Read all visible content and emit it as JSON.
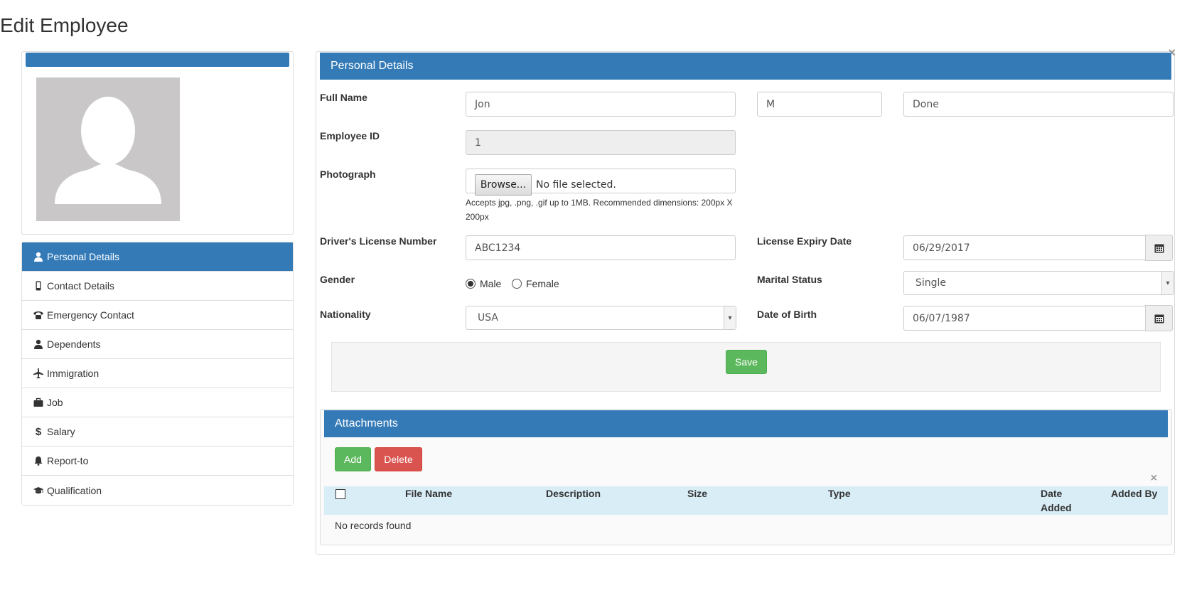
{
  "page": {
    "title": "Edit Employee"
  },
  "sidebar": {
    "items": [
      {
        "label": "Personal Details",
        "icon": "user-icon",
        "active": true
      },
      {
        "label": "Contact Details",
        "icon": "mobile-phone-icon"
      },
      {
        "label": "Emergency Contact",
        "icon": "phone-icon"
      },
      {
        "label": "Dependents",
        "icon": "user-icon"
      },
      {
        "label": "Immigration",
        "icon": "plane-icon"
      },
      {
        "label": "Job",
        "icon": "briefcase-icon"
      },
      {
        "label": "Salary",
        "icon": "dollar-icon"
      },
      {
        "label": "Report-to",
        "icon": "bell-icon"
      },
      {
        "label": "Qualification",
        "icon": "graduation-cap-icon"
      }
    ]
  },
  "personal": {
    "heading": "Personal Details",
    "full_name_label": "Full Name",
    "first_name": "Jon",
    "middle_name": "M",
    "last_name": "Done",
    "employee_id_label": "Employee ID",
    "employee_id": "1",
    "photograph_label": "Photograph",
    "browse_label": "Browse...",
    "file_status": "No file selected.",
    "photo_help_line1": "Accepts jpg, .png, .gif up to 1MB. Recommended dimensions: 200px X",
    "photo_help_line2": "200px",
    "license_label": "Driver's License Number",
    "license_number": "ABC1234",
    "license_expiry_label": "License Expiry Date",
    "license_expiry": "06/29/2017",
    "gender_label": "Gender",
    "gender_male": "Male",
    "gender_female": "Female",
    "gender_selected": "Male",
    "marital_label": "Marital Status",
    "marital_status": "Single",
    "nationality_label": "Nationality",
    "nationality": "USA",
    "dob_label": "Date of Birth",
    "dob": "06/07/1987",
    "save_label": "Save"
  },
  "attachments": {
    "heading": "Attachments",
    "add_label": "Add",
    "delete_label": "Delete",
    "columns": [
      "File Name",
      "Description",
      "Size",
      "Type",
      "Date Added",
      "Added By"
    ],
    "empty_text": "No records found"
  },
  "colors": {
    "primary": "#337ab7",
    "success": "#5cb85c",
    "danger": "#d9534f",
    "table_header": "#d9edf7"
  }
}
